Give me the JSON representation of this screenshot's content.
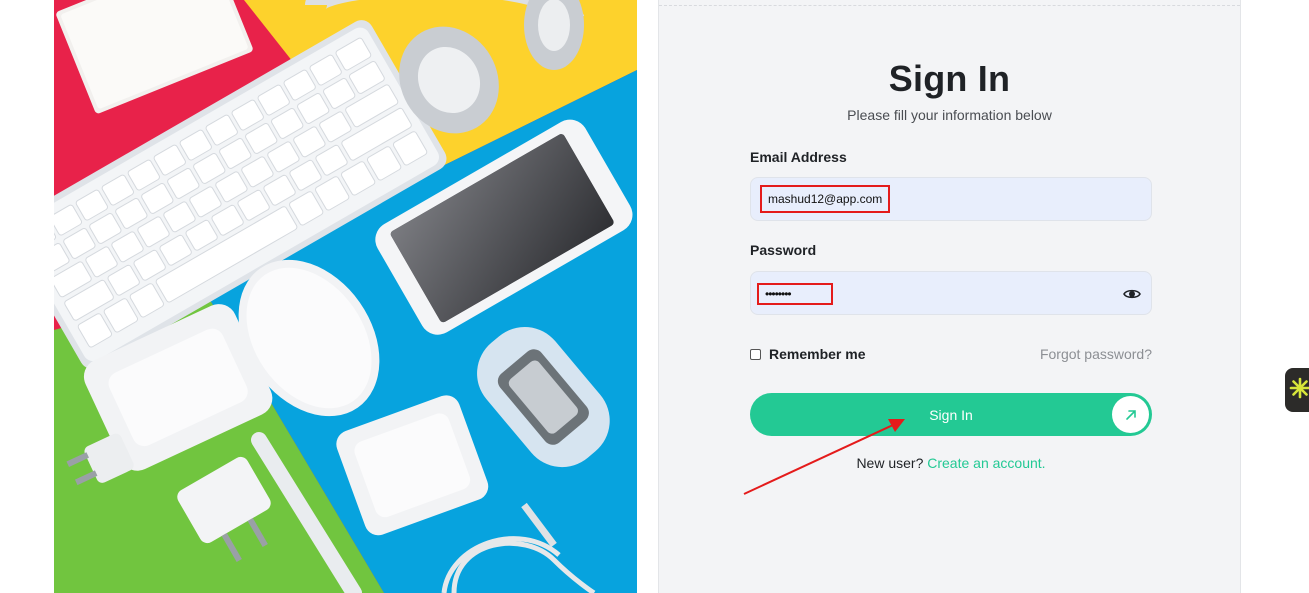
{
  "photo": {
    "alt": "Flat lay of white electronic gadgets on colorful background"
  },
  "signin": {
    "title": "Sign In",
    "subtitle": "Please fill your information below",
    "email_label": "Email Address",
    "email_value": "mashud12@app.com",
    "password_label": "Password",
    "password_value": "••••••••",
    "remember_label": "Remember me",
    "remember_checked": false,
    "forgot_label": "Forgot password?",
    "button_label": "Sign In",
    "new_user_text": "New user?",
    "create_account_label": "Create an account."
  },
  "colors": {
    "accent": "#23c994",
    "annotation": "#e41b1b",
    "panel_bg": "#f3f4f6",
    "input_bg": "#e8eefc"
  },
  "icons": {
    "password_toggle": "eye-icon",
    "button_arrow": "arrow-up-right-icon",
    "side_widget": "sparkle-icon"
  }
}
